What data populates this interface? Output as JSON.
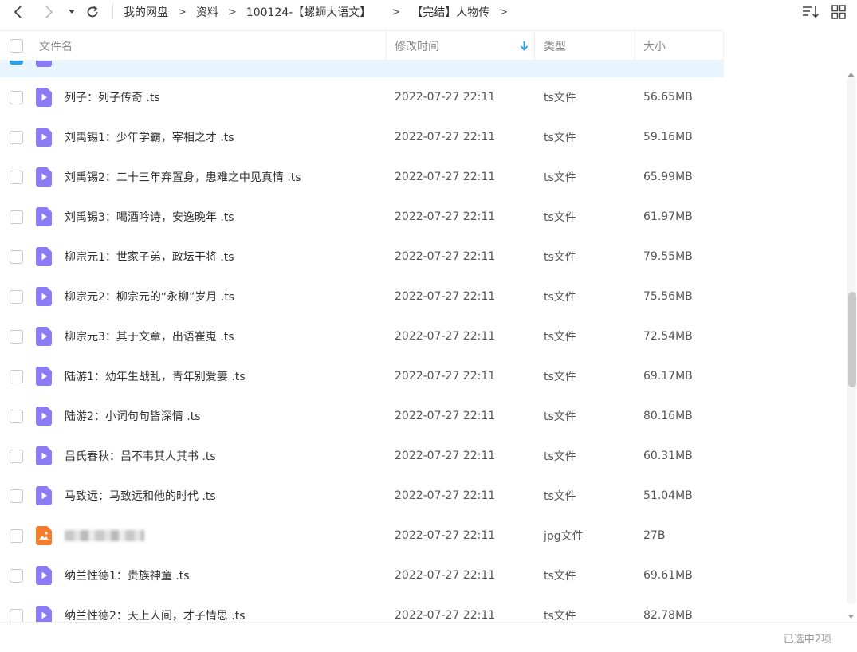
{
  "breadcrumb": {
    "items": [
      "我的网盘",
      "资料",
      "100124-【螺蛳大语文】",
      "【完结】人物传"
    ],
    "separator": ">"
  },
  "header": {
    "name": "文件名",
    "modified": "修改时间",
    "type": "类型",
    "size": "大小"
  },
  "rows": [
    {
      "name": "",
      "time": "",
      "type": "",
      "size": "",
      "selected": true,
      "kind": "ts",
      "partial": true
    },
    {
      "name": "列子：列子传奇 .ts",
      "time": "2022-07-27 22:11",
      "type": "ts文件",
      "size": "56.65MB",
      "kind": "ts"
    },
    {
      "name": "刘禹锡1：少年学霸，宰相之才 .ts",
      "time": "2022-07-27 22:11",
      "type": "ts文件",
      "size": "59.16MB",
      "kind": "ts"
    },
    {
      "name": "刘禹锡2：二十三年弃置身，患难之中见真情 .ts",
      "time": "2022-07-27 22:11",
      "type": "ts文件",
      "size": "65.99MB",
      "kind": "ts"
    },
    {
      "name": "刘禹锡3：喝酒吟诗，安逸晚年 .ts",
      "time": "2022-07-27 22:11",
      "type": "ts文件",
      "size": "61.97MB",
      "kind": "ts"
    },
    {
      "name": "柳宗元1：世家子弟，政坛干将 .ts",
      "time": "2022-07-27 22:11",
      "type": "ts文件",
      "size": "79.55MB",
      "kind": "ts"
    },
    {
      "name": "柳宗元2：柳宗元的“永柳”岁月 .ts",
      "time": "2022-07-27 22:11",
      "type": "ts文件",
      "size": "75.56MB",
      "kind": "ts"
    },
    {
      "name": "柳宗元3：其于文章，出语崔嵬 .ts",
      "time": "2022-07-27 22:11",
      "type": "ts文件",
      "size": "72.54MB",
      "kind": "ts"
    },
    {
      "name": "陆游1：幼年生战乱，青年别爱妻 .ts",
      "time": "2022-07-27 22:11",
      "type": "ts文件",
      "size": "69.17MB",
      "kind": "ts"
    },
    {
      "name": "陆游2：小词句句皆深情 .ts",
      "time": "2022-07-27 22:11",
      "type": "ts文件",
      "size": "80.16MB",
      "kind": "ts"
    },
    {
      "name": "吕氏春秋：吕不韦其人其书 .ts",
      "time": "2022-07-27 22:11",
      "type": "ts文件",
      "size": "60.31MB",
      "kind": "ts"
    },
    {
      "name": "马致远：马致远和他的时代 .ts",
      "time": "2022-07-27 22:11",
      "type": "ts文件",
      "size": "51.04MB",
      "kind": "ts"
    },
    {
      "name": "",
      "time": "2022-07-27 22:11",
      "type": "jpg文件",
      "size": "27B",
      "kind": "jpg",
      "blurred": true
    },
    {
      "name": "纳兰性德1：贵族神童 .ts",
      "time": "2022-07-27 22:11",
      "type": "ts文件",
      "size": "69.61MB",
      "kind": "ts"
    },
    {
      "name": "纳兰性德2：天上人间，才子情思 .ts",
      "time": "2022-07-27 22:11",
      "type": "ts文件",
      "size": "82.78MB",
      "kind": "ts"
    }
  ],
  "status": {
    "selection": "已选中2项"
  },
  "colors": {
    "accent": "#2a9fe8",
    "video_icon": "#8b7cf6",
    "image_icon": "#f57c2b",
    "selected_row": "#e8f5fe"
  }
}
